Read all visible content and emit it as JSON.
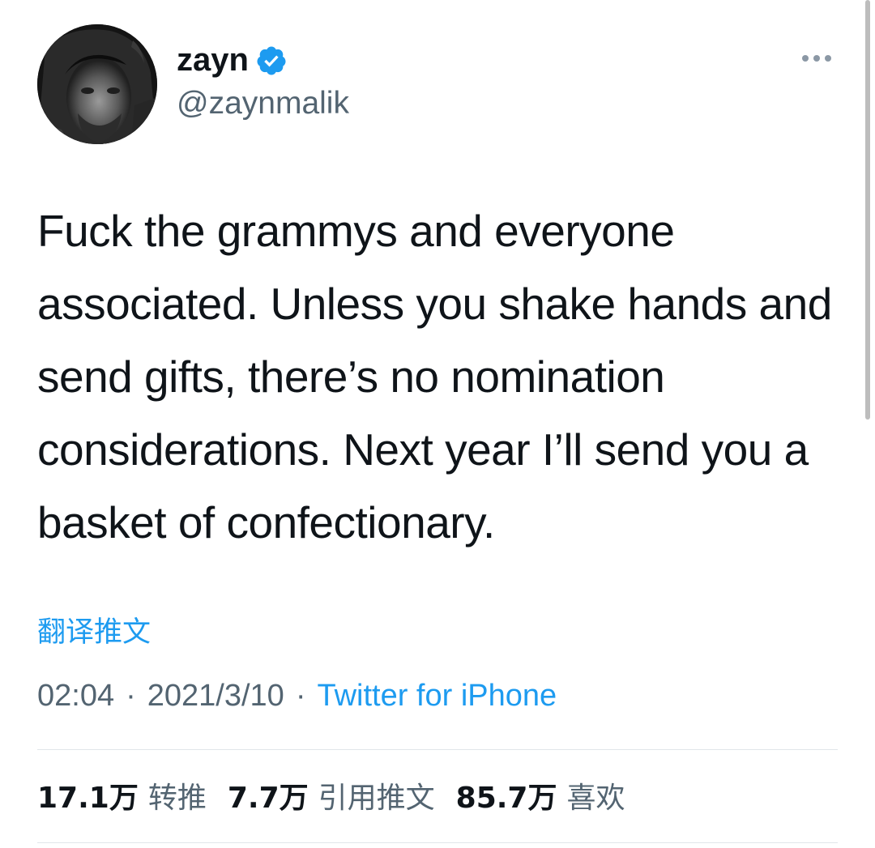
{
  "tweet": {
    "author": {
      "display_name": "zayn",
      "handle": "@zaynmalik",
      "verified": true
    },
    "text": "Fuck the grammys and everyone associated. Unless you shake hands and send gifts, there’s no nomination considerations. Next year I’ll send you a basket of confectionary.",
    "translate_label": "翻译推文",
    "time": "02:04",
    "date": "2021/3/10",
    "separator": "·",
    "source": "Twitter for iPhone",
    "stats": {
      "retweets": {
        "count": "17.1万",
        "label": "转推"
      },
      "quotes": {
        "count": "7.7万",
        "label": "引用推文"
      },
      "likes": {
        "count": "85.7万",
        "label": "喜欢"
      }
    }
  },
  "icons": {
    "verified": "verified-badge-icon",
    "more": "more-options-icon"
  },
  "colors": {
    "accent": "#1d9bf0",
    "text_primary": "#0f1419",
    "text_secondary": "#536471",
    "divider": "#e1e6ea"
  }
}
